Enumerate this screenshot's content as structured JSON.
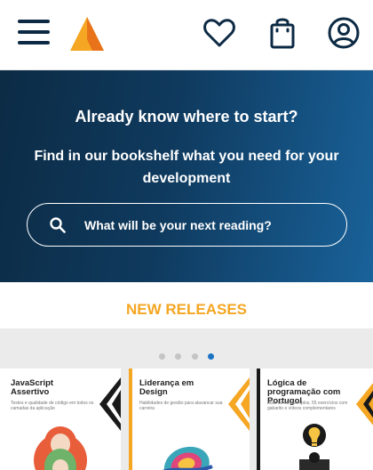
{
  "header": {
    "menu_icon": "hamburger-menu-icon",
    "logo_icon": "triangle-logo",
    "favorites_icon": "heart-icon",
    "cart_icon": "shopping-bag-icon",
    "account_icon": "user-circle-icon"
  },
  "hero": {
    "title": "Already know where to start?",
    "subtitle": "Find in our bookshelf what you need for your development",
    "search": {
      "placeholder": "What will be your next reading?",
      "icon": "search-icon"
    }
  },
  "releases": {
    "title": "NEW RELEASES",
    "active_slide": 4,
    "slide_count": 4,
    "books": [
      {
        "title": "JavaScript Assertivo",
        "subtitle": "Testes e qualidade de código em todos os camadas da aplicação"
      },
      {
        "title": "Liderança em Design",
        "subtitle": "Habilidades de gestão para alavancar sua carreira"
      },
      {
        "title": "Lógica de programação com Portugol",
        "subtitle": "Mais de 80 exemplos, 55 exercícios com gabarito e vídeos complementares"
      }
    ]
  },
  "colors": {
    "navy": "#0d2a44",
    "accent_orange": "#f5a623",
    "dot_active": "#1a73c4",
    "dot_inactive": "#c4c4c4"
  }
}
